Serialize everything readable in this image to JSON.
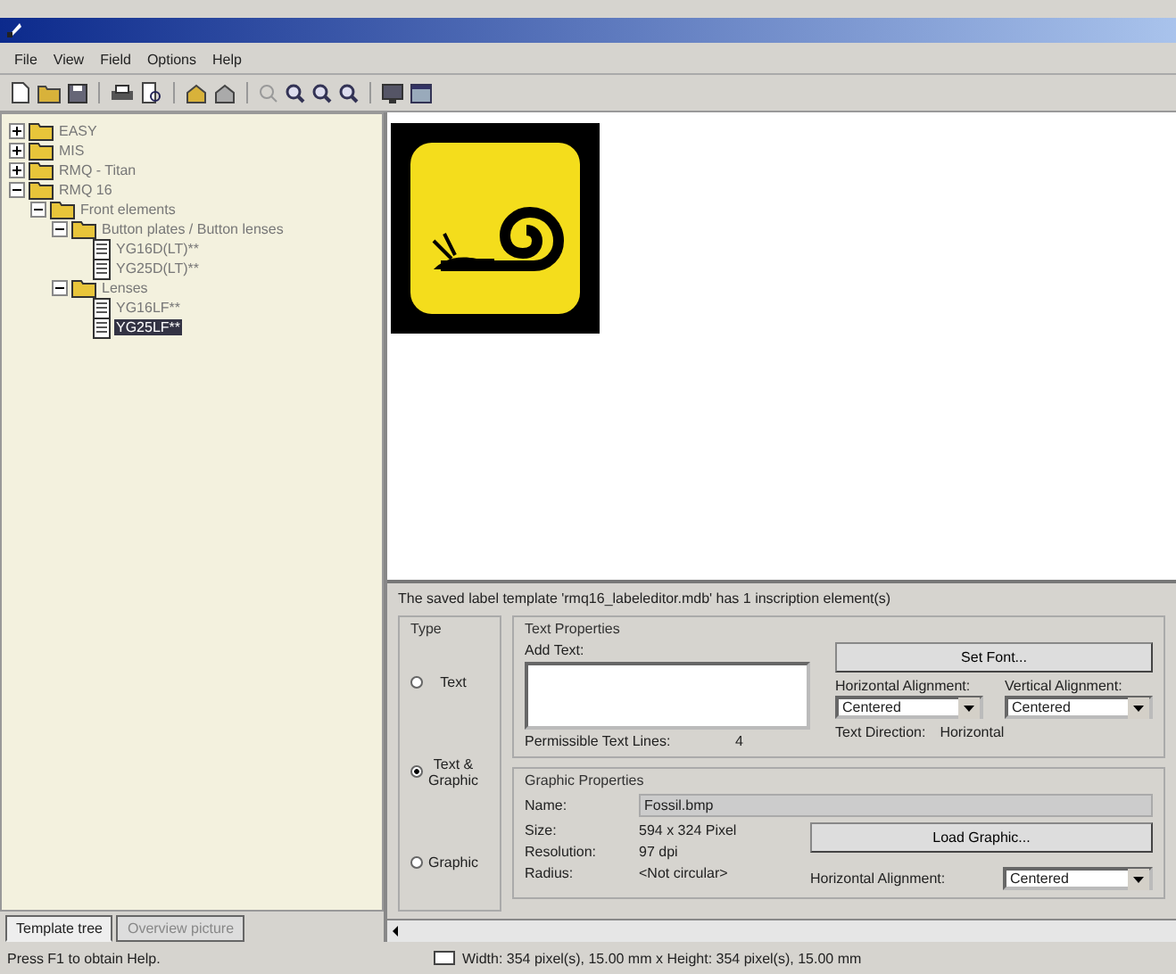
{
  "menu": [
    "File",
    "View",
    "Field",
    "Options",
    "Help"
  ],
  "tree": [
    {
      "kind": "folder",
      "label": "EASY",
      "expanded": false,
      "selected": false
    },
    {
      "kind": "folder",
      "label": "MIS",
      "expanded": false,
      "selected": false
    },
    {
      "kind": "folder",
      "label": "RMQ - Titan",
      "expanded": false,
      "selected": false
    },
    {
      "kind": "folder",
      "label": "RMQ 16",
      "expanded": true,
      "selected": false,
      "children": [
        {
          "kind": "folder",
          "label": "Front elements",
          "expanded": true,
          "selected": false,
          "children": [
            {
              "kind": "folder",
              "label": "Button plates / Button lenses",
              "expanded": true,
              "selected": false,
              "children": [
                {
                  "kind": "document",
                  "label": "YG16D(LT)**",
                  "selected": false
                },
                {
                  "kind": "document",
                  "label": "YG25D(LT)**",
                  "selected": false
                }
              ]
            },
            {
              "kind": "folder",
              "label": "Lenses",
              "expanded": true,
              "selected": false,
              "children": [
                {
                  "kind": "document",
                  "label": "YG16LF**",
                  "selected": false
                },
                {
                  "kind": "document",
                  "label": "YG25LF**",
                  "selected": true
                }
              ]
            }
          ]
        }
      ]
    }
  ],
  "left_tabs": [
    {
      "label": "Template tree",
      "selected": true
    },
    {
      "label": "Overview picture",
      "selected": false
    }
  ],
  "message": "The saved label template 'rmq16_labeleditor.mdb' has 1 inscription element(s)",
  "type_group": {
    "title": "Type",
    "options": [
      {
        "label": "Text",
        "selected": false
      },
      {
        "label": "Text & Graphic",
        "selected": true
      },
      {
        "label": "Graphic",
        "selected": false
      }
    ]
  },
  "text_properties": {
    "title": "Text Properties",
    "add_text_label": "Add Text:",
    "set_font_button": "Set Font...",
    "horizontal_alignment": {
      "label": "Horizontal Alignment:",
      "value": "Centered"
    },
    "vertical_alignment": {
      "label": "Vertical Alignment:",
      "value": "Centered"
    },
    "lines_label": "Permissible Text Lines:",
    "lines_value": "4",
    "direction_label": "Text Direction:",
    "direction_value": "Horizontal"
  },
  "graphic_properties": {
    "title": "Graphic Properties",
    "name_label": "Name:",
    "name_value": "Fossil.bmp",
    "size_label": "Size:",
    "size_value": "594 x 324 Pixel",
    "resolution_label": "Resolution:",
    "resolution_value": "97 dpi",
    "radius_label": "Radius:",
    "radius_value": "<Not circular>",
    "load_button": "Load Graphic...",
    "horizontal_alignment": {
      "label": "Horizontal Alignment:",
      "value": "Centered"
    }
  },
  "status_bar": {
    "help": "Press F1 to obtain Help.",
    "dimensions": "Width: 354 pixel(s), 15.00 mm x Height: 354 pixel(s), 15.00 mm"
  }
}
